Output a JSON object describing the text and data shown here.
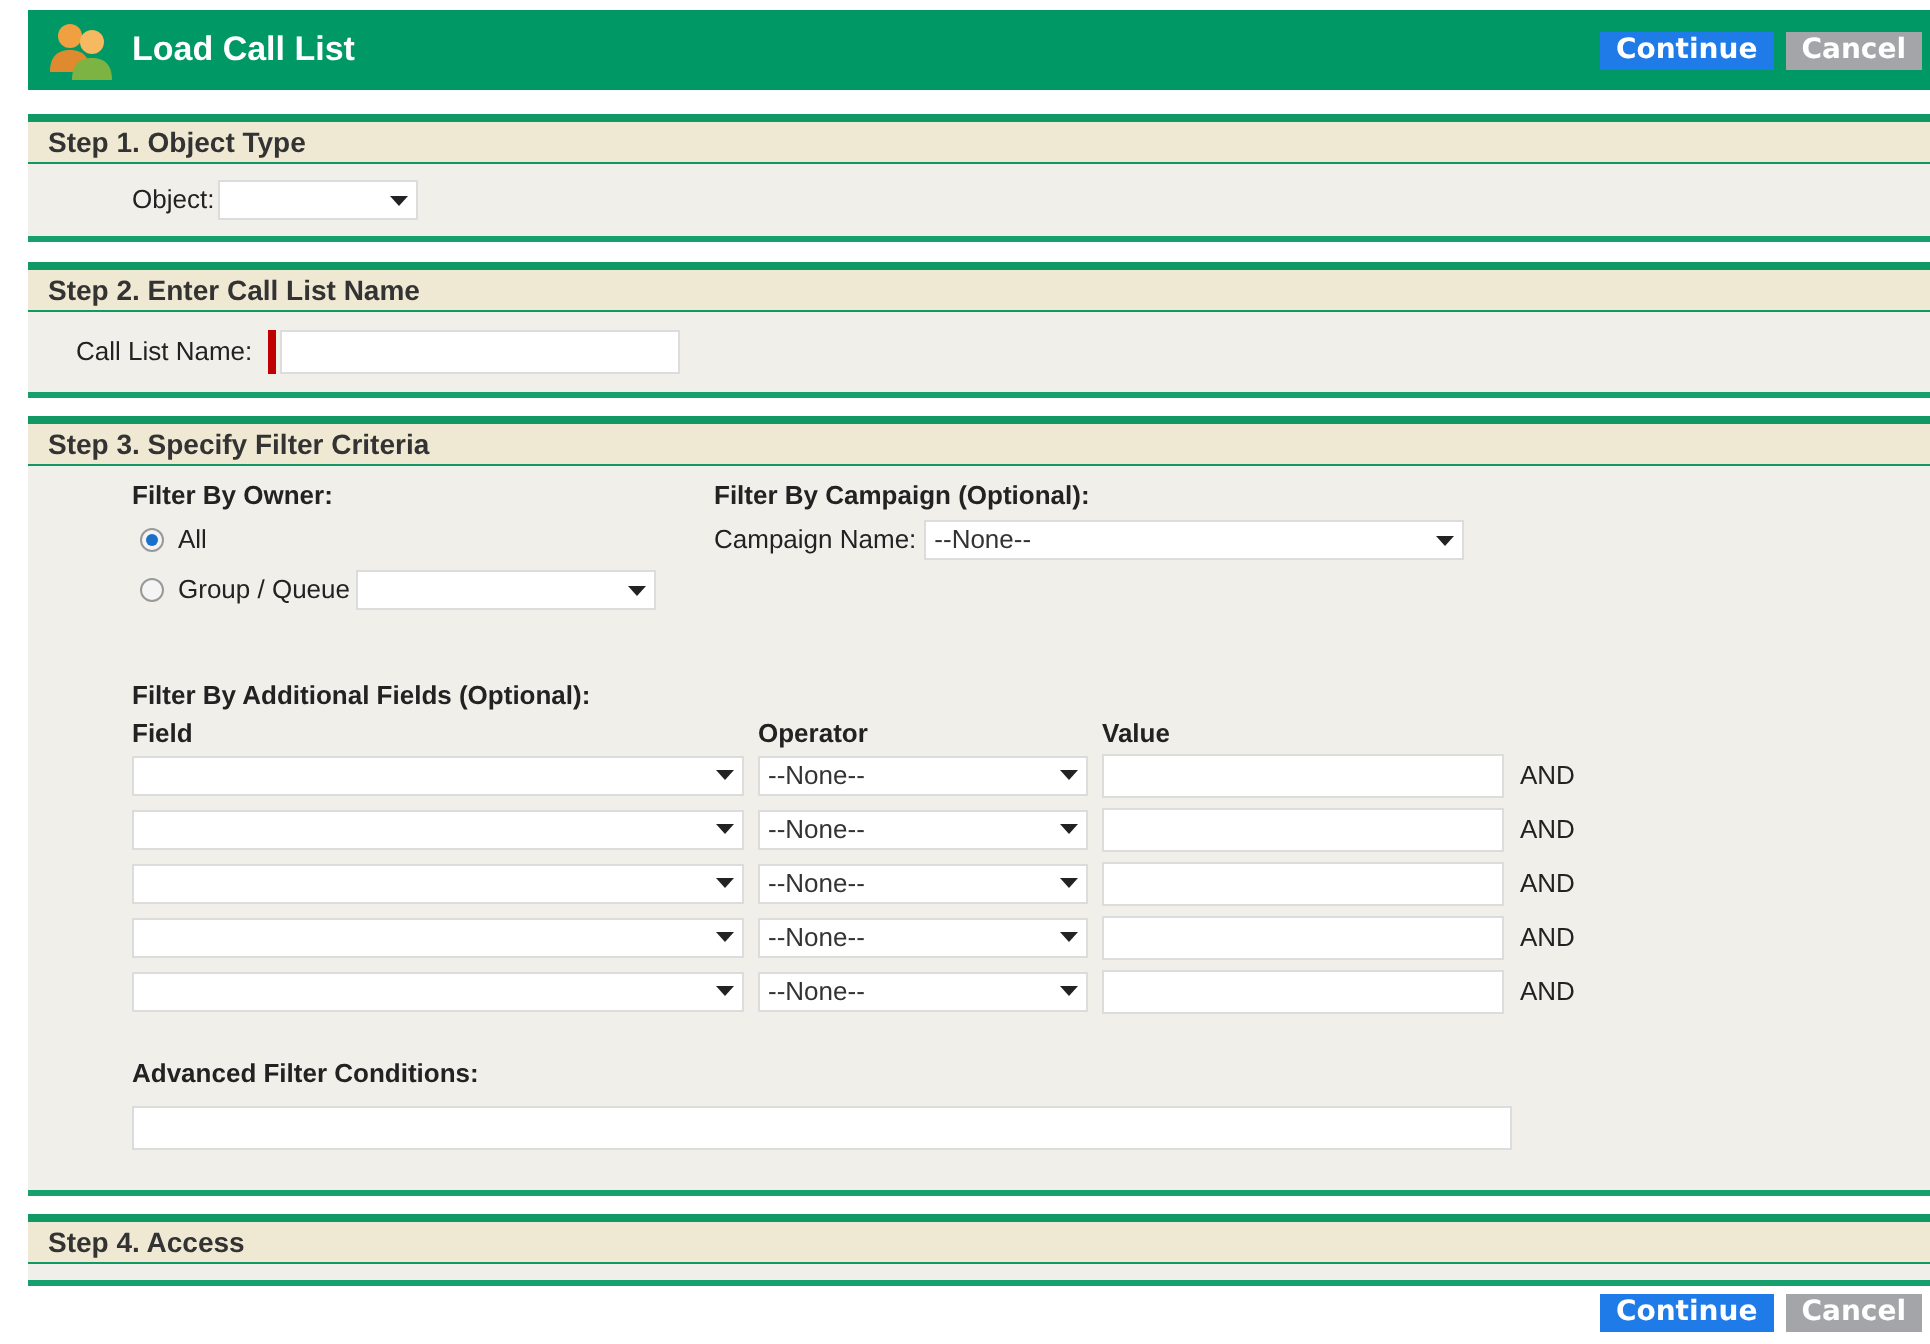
{
  "header": {
    "title": "Load Call List",
    "buttons": [
      {
        "label": "Continue",
        "kind": "primary"
      },
      {
        "label": "Cancel",
        "kind": "secondary"
      }
    ]
  },
  "step1": {
    "title": "Step 1. Object Type",
    "object_label": "Object:"
  },
  "step2": {
    "title": "Step 2. Enter Call List Name",
    "name_label": "Call List Name:",
    "required": true
  },
  "step3": {
    "title": "Step 3. Specify Filter Criteria",
    "owner_heading": "Filter By Owner:",
    "owner_options": [
      {
        "label": "All",
        "selected": true,
        "has_select": false
      },
      {
        "label": "Group / Queue",
        "selected": false,
        "has_select": true
      }
    ],
    "campaign_heading": "Filter By Campaign (Optional):",
    "campaign_label": "Campaign Name:",
    "campaign_value": "--None--",
    "additional_heading": "Filter By Additional Fields (Optional):",
    "columns": [
      "Field",
      "Operator",
      "Value"
    ],
    "rows": [
      {
        "operator": "--None--",
        "conjunction": "AND"
      },
      {
        "operator": "--None--",
        "conjunction": "AND"
      },
      {
        "operator": "--None--",
        "conjunction": "AND"
      },
      {
        "operator": "--None--",
        "conjunction": "AND"
      },
      {
        "operator": "--None--",
        "conjunction": "AND"
      }
    ],
    "advanced_label": "Advanced Filter Conditions:"
  },
  "step4": {
    "title": "Step 4. Access"
  },
  "footer_buttons": [
    {
      "label": "Continue",
      "kind": "primary"
    },
    {
      "label": "Cancel",
      "kind": "secondary"
    }
  ]
}
